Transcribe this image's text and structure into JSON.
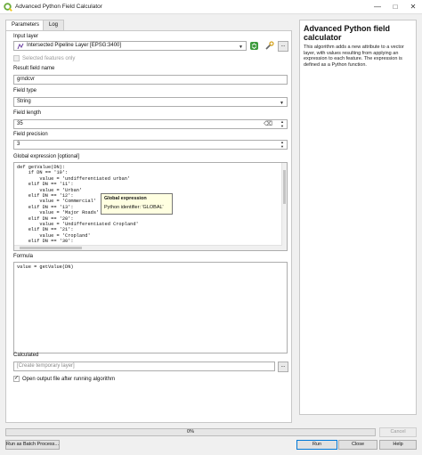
{
  "window": {
    "title": "Advanced Python Field Calculator",
    "minimize_glyph": "—",
    "maximize_glyph": "□",
    "close_glyph": "✕"
  },
  "tabs": [
    "Parameters",
    "Log"
  ],
  "params": {
    "input_layer_label": "Input layer",
    "input_layer_value": "Intersected Pipeline Layer [EPSG:3400]",
    "selected_only_label": "Selected features only",
    "result_field_label": "Result field name",
    "result_field_value": "grndcvr",
    "field_type_label": "Field type",
    "field_type_value": "String",
    "field_length_label": "Field length",
    "field_length_value": "35",
    "field_precision_label": "Field precision",
    "field_precision_value": "3",
    "global_expr_label": "Global expression [optional]",
    "global_expr_lines": [
      "def getValue(DN):",
      "    if DN == '10':",
      "        value = 'undifferentiated urban'",
      "    elif DN == '11':",
      "        value = 'Urban'",
      "    elif DN == '12':",
      "        value = 'Commercial'",
      "    elif DN == '13':",
      "        value = 'Major Roads'",
      "    elif DN == '20':",
      "        value = 'Undifferentiated Cropland'",
      "    elif DN == '21':",
      "        value = 'Cropland'",
      "    elif DN == '30':"
    ],
    "tooltip_title": "Global expression",
    "tooltip_body": "Python identifier: 'GLOBAL'",
    "formula_label": "Formula",
    "formula_value": "value = getValue(DN)",
    "calculated_label": "Calculated",
    "calculated_placeholder": "[Create temporary layer]",
    "open_output_label": "Open output file after running algorithm",
    "more_glyph": "..."
  },
  "help": {
    "title": "Advanced Python field calculator",
    "description": "This algorithm adds a new attribute to a vector layer, with values resulting from applying an expression to each feature. The expression is defined as a Python function."
  },
  "progress": {
    "percent_label": "0%",
    "value": 0
  },
  "buttons": {
    "cancel": "Cancel",
    "batch": "Run as Batch Process...",
    "run": "Run",
    "close": "Close",
    "help": "Help"
  },
  "icons": {
    "app": "qgis-logo-icon",
    "layer": "line-layer-icon",
    "iterate": "iterate-icon",
    "settings": "wrench-icon",
    "clear": "backspace-icon"
  },
  "colors": {
    "qgis_green": "#6aab3c",
    "tooltip_bg": "#ffffe1",
    "primary_border": "#0078d7"
  }
}
